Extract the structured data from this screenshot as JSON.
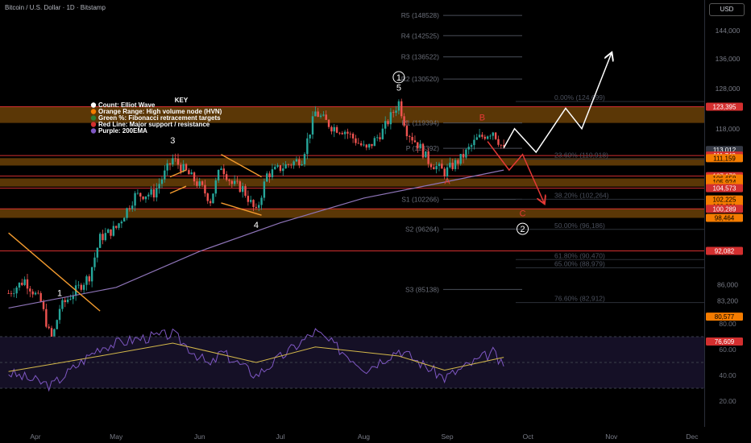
{
  "header": {
    "symbol": "Bitcoin / U.S. Dollar · 1D · Bitstamp",
    "currency_button": "USD"
  },
  "colors": {
    "background": "#000000",
    "candle_up": "#26a69a",
    "candle_down": "#ef5350",
    "hvn_zone": "#7a4a08",
    "support_line": "#d32f2f",
    "ema": "#8e74b8",
    "rsi_line": "#7e57c2",
    "rsi_ma": "#d4b84a",
    "fib_text": "#4a4f5c",
    "pivot_text": "#6b6f7a",
    "badge_orange": "#f57c00",
    "badge_red": "#d32f2f",
    "badge_grey": "#363a45",
    "projection_bull": "#ffffff",
    "projection_bear": "#e53935",
    "trendline": "#f29a2e"
  },
  "chart_data": {
    "type": "candlestick",
    "price_axis": {
      "scale": "log",
      "ticks": [
        {
          "label": "144,000",
          "value": 144000
        },
        {
          "label": "136,000",
          "value": 136000
        },
        {
          "label": "128,000",
          "value": 128000
        },
        {
          "label": "118,000",
          "value": 118000
        },
        {
          "label": "86,000",
          "value": 86000
        },
        {
          "label": "83,200",
          "value": 83200
        }
      ]
    },
    "time_axis": {
      "labels": [
        {
          "label": "Apr",
          "date": "2025-04-01"
        },
        {
          "label": "May",
          "date": "2025-05-01"
        },
        {
          "label": "Jun",
          "date": "2025-06-01"
        },
        {
          "label": "Jul",
          "date": "2025-07-01"
        },
        {
          "label": "Aug",
          "date": "2025-08-01"
        },
        {
          "label": "Sep",
          "date": "2025-09-01"
        },
        {
          "label": "Oct",
          "date": "2025-10-01"
        },
        {
          "label": "Nov",
          "date": "2025-11-01"
        },
        {
          "label": "Dec",
          "date": "2025-12-01"
        }
      ]
    },
    "price_path": [
      {
        "date": "2025-03-22",
        "price": 84500
      },
      {
        "date": "2025-03-28",
        "price": 86800
      },
      {
        "date": "2025-04-03",
        "price": 83000
      },
      {
        "date": "2025-04-07",
        "price": 76500
      },
      {
        "date": "2025-04-10",
        "price": 82000
      },
      {
        "date": "2025-04-14",
        "price": 84000
      },
      {
        "date": "2025-04-21",
        "price": 87500
      },
      {
        "date": "2025-04-25",
        "price": 94500
      },
      {
        "date": "2025-05-01",
        "price": 96500
      },
      {
        "date": "2025-05-08",
        "price": 103000
      },
      {
        "date": "2025-05-15",
        "price": 103500
      },
      {
        "date": "2025-05-22",
        "price": 111000
      },
      {
        "date": "2025-05-28",
        "price": 107500
      },
      {
        "date": "2025-06-02",
        "price": 104500
      },
      {
        "date": "2025-06-05",
        "price": 102000
      },
      {
        "date": "2025-06-09",
        "price": 109500
      },
      {
        "date": "2025-06-13",
        "price": 105500
      },
      {
        "date": "2025-06-17",
        "price": 104500
      },
      {
        "date": "2025-06-22",
        "price": 99500
      },
      {
        "date": "2025-06-26",
        "price": 107500
      },
      {
        "date": "2025-07-03",
        "price": 109500
      },
      {
        "date": "2025-07-09",
        "price": 111000
      },
      {
        "date": "2025-07-14",
        "price": 122000
      },
      {
        "date": "2025-07-20",
        "price": 118500
      },
      {
        "date": "2025-07-25",
        "price": 117500
      },
      {
        "date": "2025-08-02",
        "price": 113000
      },
      {
        "date": "2025-08-08",
        "price": 117500
      },
      {
        "date": "2025-08-14",
        "price": 124500
      },
      {
        "date": "2025-08-17",
        "price": 117500
      },
      {
        "date": "2025-08-22",
        "price": 113500
      },
      {
        "date": "2025-08-25",
        "price": 110500
      },
      {
        "date": "2025-08-31",
        "price": 108000
      },
      {
        "date": "2025-09-06",
        "price": 111000
      },
      {
        "date": "2025-09-12",
        "price": 115500
      },
      {
        "date": "2025-09-18",
        "price": 117500
      },
      {
        "date": "2025-09-22",
        "price": 113000
      }
    ],
    "ema200": [
      {
        "date": "2025-03-22",
        "price": 82000
      },
      {
        "date": "2025-05-01",
        "price": 85500
      },
      {
        "date": "2025-06-01",
        "price": 92000
      },
      {
        "date": "2025-07-01",
        "price": 97500
      },
      {
        "date": "2025-08-01",
        "price": 102500
      },
      {
        "date": "2025-09-01",
        "price": 106000
      },
      {
        "date": "2025-09-22",
        "price": 108500
      }
    ],
    "hvn_zones": [
      {
        "from": 119394,
        "to": 123395
      },
      {
        "from": 109500,
        "to": 111159
      },
      {
        "from": 104920,
        "to": 106658
      },
      {
        "from": 98464,
        "to": 100357
      },
      {
        "from": 75500,
        "to": 76609
      }
    ],
    "support_resistance": [
      123395,
      111748,
      107179,
      104573,
      100289,
      92082,
      76609
    ],
    "pivots": [
      {
        "label": "R5 (148528)",
        "value": 148528
      },
      {
        "label": "R4 (142525)",
        "value": 142525
      },
      {
        "label": "R3 (136522)",
        "value": 136522
      },
      {
        "label": "R2 (130520)",
        "value": 130520
      },
      {
        "label": "R1 (119394)",
        "value": 119394
      },
      {
        "label": "P (113392)",
        "value": 113392
      },
      {
        "label": "S1 (102266)",
        "value": 102266
      },
      {
        "label": "S2 (96264)",
        "value": 96264
      },
      {
        "label": "S3 (85138)",
        "value": 85138
      }
    ],
    "fib_levels": [
      {
        "label": "0.00% (124,699)",
        "value": 124699
      },
      {
        "label": "23.60% (110,918)",
        "value": 110918
      },
      {
        "label": "38.20% (102,264)",
        "value": 102264
      },
      {
        "label": "50.00% (96,186)",
        "value": 96186
      },
      {
        "label": "61.80% (90,470)",
        "value": 90470
      },
      {
        "label": "65.00% (88,979)",
        "value": 88979
      },
      {
        "label": "76.60% (82,912)",
        "value": 82912
      }
    ],
    "price_badges": [
      {
        "label": "123,395",
        "value": 123395,
        "style": "badge_red"
      },
      {
        "label": "113,012",
        "value": 113012,
        "style": "badge_grey"
      },
      {
        "label": "111,748",
        "value": 111748,
        "style": "badge_red"
      },
      {
        "label": "111,159",
        "value": 111159,
        "style": "badge_orange"
      },
      {
        "label": "107,179",
        "value": 107179,
        "style": "badge_red"
      },
      {
        "label": "106,658",
        "value": 106658,
        "style": "badge_orange"
      },
      {
        "label": "105,924",
        "value": 105924,
        "style": "badge_orange"
      },
      {
        "label": "104,920",
        "value": 104920,
        "style": "badge_orange"
      },
      {
        "label": "104,573",
        "value": 104573,
        "style": "badge_red"
      },
      {
        "label": "102,225",
        "value": 102225,
        "style": "badge_orange"
      },
      {
        "label": "100,821",
        "value": 100821,
        "style": "badge_orange"
      },
      {
        "label": "100,357",
        "value": 100357,
        "style": "badge_orange"
      },
      {
        "label": "100,289",
        "value": 100289,
        "style": "badge_red"
      },
      {
        "label": "98,464",
        "value": 98464,
        "style": "badge_orange"
      },
      {
        "label": "92,082",
        "value": 92082,
        "style": "badge_red"
      },
      {
        "label": "80,577",
        "value": 80577,
        "style": "badge_orange"
      },
      {
        "label": "76,609",
        "value": 76609,
        "style": "badge_red"
      }
    ],
    "wave_labels": [
      {
        "label": "1",
        "date": "2025-04-10",
        "price": 84000,
        "color": "white"
      },
      {
        "label": "3",
        "date": "2025-05-22",
        "price": 114500,
        "color": "white"
      },
      {
        "label": "4",
        "date": "2025-06-22",
        "price": 96500,
        "color": "white"
      },
      {
        "label": "5",
        "date": "2025-08-14",
        "price": 127500,
        "color": "white"
      },
      {
        "label": "A",
        "date": "2025-09-01",
        "price": 105500,
        "color": "red"
      },
      {
        "label": "B",
        "date": "2025-09-14",
        "price": 120000,
        "color": "red"
      },
      {
        "label": "C",
        "date": "2025-09-29",
        "price": 98800,
        "color": "red"
      }
    ],
    "circled_labels": [
      {
        "label": "1",
        "date": "2025-08-14",
        "price": 131000
      },
      {
        "label": "2",
        "date": "2025-09-29",
        "price": 96300
      }
    ],
    "projection_bull": [
      {
        "date": "2025-09-22",
        "price": 113500
      },
      {
        "date": "2025-09-26",
        "price": 118000
      },
      {
        "date": "2025-10-04",
        "price": 112500
      },
      {
        "date": "2025-10-15",
        "price": 123000
      },
      {
        "date": "2025-10-21",
        "price": 118000
      },
      {
        "date": "2025-11-01",
        "price": 137500
      }
    ],
    "projection_bear": [
      {
        "date": "2025-09-16",
        "price": 115000
      },
      {
        "date": "2025-09-24",
        "price": 108500
      },
      {
        "date": "2025-09-29",
        "price": 112000
      },
      {
        "date": "2025-10-07",
        "price": 101500
      }
    ],
    "trendlines": [
      {
        "from": {
          "date": "2025-03-22",
          "price": 95500
        },
        "to": {
          "date": "2025-04-25",
          "price": 81500
        }
      },
      {
        "from": {
          "date": "2025-06-09",
          "price": 112000
        },
        "to": {
          "date": "2025-06-24",
          "price": 107000
        }
      },
      {
        "from": {
          "date": "2025-06-09",
          "price": 101500
        },
        "to": {
          "date": "2025-06-24",
          "price": 99000
        }
      },
      {
        "from": {
          "date": "2025-05-21",
          "price": 107000
        },
        "to": {
          "date": "2025-05-27",
          "price": 108500
        }
      },
      {
        "from": {
          "date": "2025-05-21",
          "price": 103500
        },
        "to": {
          "date": "2025-05-27",
          "price": 105000
        }
      }
    ],
    "legend": {
      "title": "KEY",
      "items": [
        {
          "label": "Count: Elliot Wave",
          "color": "#ffffff"
        },
        {
          "label": "Orange Range: High volume node (HVN)",
          "color": "#f57c00"
        },
        {
          "label": "Green %: Fibonacci retracement targets",
          "color": "#2e7d32"
        },
        {
          "label": "Red Line: Major support / resistance",
          "color": "#d32f2f"
        },
        {
          "label": "Purple: 200EMA",
          "color": "#7e57c2"
        }
      ]
    },
    "rsi": {
      "ticks": [
        {
          "label": "80.00",
          "value": 80
        },
        {
          "label": "60.00",
          "value": 60
        },
        {
          "label": "40.00",
          "value": 40
        },
        {
          "label": "20.00",
          "value": 20
        }
      ],
      "bands": [
        70,
        50,
        30
      ],
      "path": [
        {
          "date": "2025-03-22",
          "value": 42
        },
        {
          "date": "2025-04-07",
          "value": 32
        },
        {
          "date": "2025-04-25",
          "value": 62
        },
        {
          "date": "2025-05-08",
          "value": 68
        },
        {
          "date": "2025-05-22",
          "value": 72
        },
        {
          "date": "2025-06-05",
          "value": 47
        },
        {
          "date": "2025-06-09",
          "value": 58
        },
        {
          "date": "2025-06-22",
          "value": 40
        },
        {
          "date": "2025-07-14",
          "value": 74
        },
        {
          "date": "2025-08-02",
          "value": 45
        },
        {
          "date": "2025-08-14",
          "value": 60
        },
        {
          "date": "2025-08-31",
          "value": 38
        },
        {
          "date": "2025-09-18",
          "value": 58
        },
        {
          "date": "2025-09-22",
          "value": 45
        }
      ],
      "ma": [
        {
          "date": "2025-03-22",
          "value": 43
        },
        {
          "date": "2025-04-25",
          "value": 55
        },
        {
          "date": "2025-05-22",
          "value": 65
        },
        {
          "date": "2025-06-22",
          "value": 50
        },
        {
          "date": "2025-07-14",
          "value": 62
        },
        {
          "date": "2025-08-14",
          "value": 55
        },
        {
          "date": "2025-08-31",
          "value": 44
        },
        {
          "date": "2025-09-22",
          "value": 54
        }
      ]
    }
  }
}
